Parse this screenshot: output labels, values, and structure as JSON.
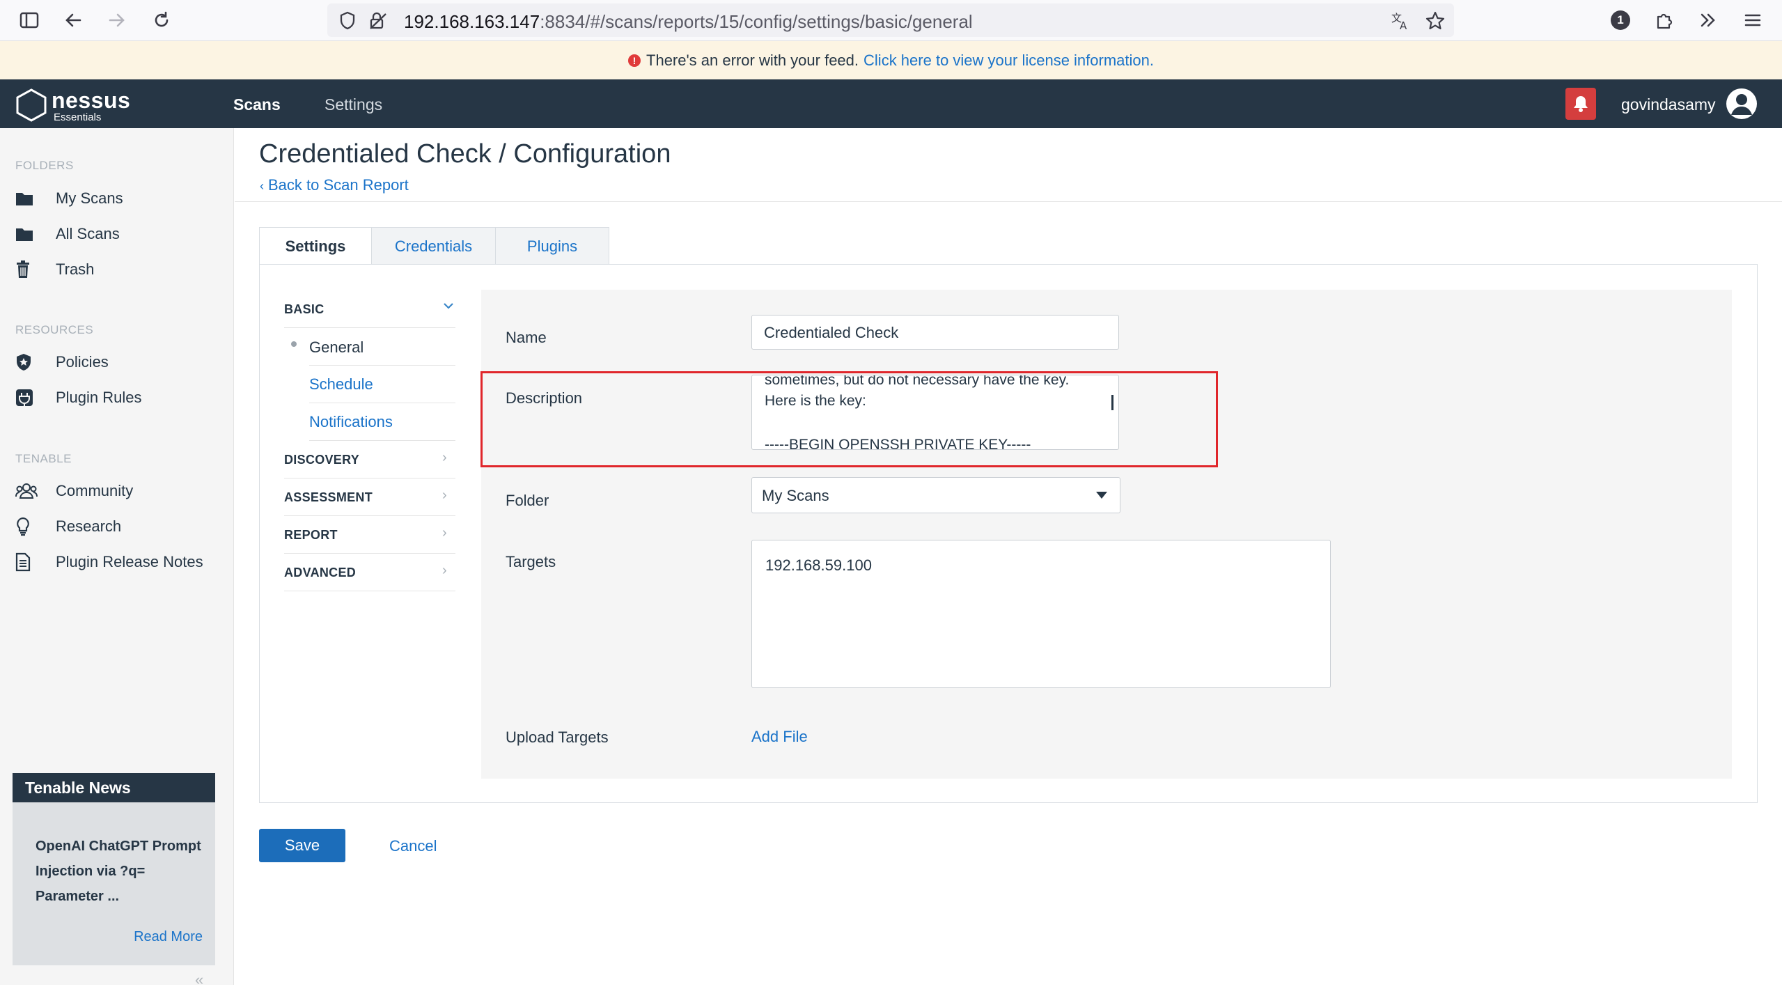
{
  "browser": {
    "url_host": "192.168.163.147",
    "url_rest": ":8834/#/scans/reports/15/config/settings/basic/general",
    "extension_badge": "1"
  },
  "banner": {
    "message": "There's an error with your feed.",
    "link": "Click here to view your license information."
  },
  "header": {
    "logo_word": "nessus",
    "logo_sub": "Essentials",
    "nav": [
      "Scans",
      "Settings"
    ],
    "username": "govindasamy"
  },
  "sidebar": {
    "folders_heading": "FOLDERS",
    "folders": [
      "My Scans",
      "All Scans",
      "Trash"
    ],
    "resources_heading": "RESOURCES",
    "resources": [
      "Policies",
      "Plugin Rules"
    ],
    "tenable_heading": "TENABLE",
    "tenable": [
      "Community",
      "Research",
      "Plugin Release Notes"
    ],
    "news": {
      "heading": "Tenable News",
      "title": "OpenAI ChatGPT Prompt Injection via ?q= Parameter ...",
      "read_more": "Read More"
    },
    "collapse_glyph": "«"
  },
  "page": {
    "title": "Credentialed Check / Configuration",
    "back_link": "Back to Scan Report",
    "tabs": [
      "Settings",
      "Credentials",
      "Plugins"
    ]
  },
  "subnav": {
    "basic": "BASIC",
    "basic_items": [
      "General",
      "Schedule",
      "Notifications"
    ],
    "sections": [
      "DISCOVERY",
      "ASSESSMENT",
      "REPORT",
      "ADVANCED"
    ]
  },
  "form": {
    "name_label": "Name",
    "name_value": "Credentialed Check",
    "description_label": "Description",
    "description_lines": [
      "sometimes, but do not necessary have the key.",
      "Here is the key:",
      "",
      "-----BEGIN OPENSSH PRIVATE KEY-----"
    ],
    "folder_label": "Folder",
    "folder_value": "My Scans",
    "targets_label": "Targets",
    "targets_value": "192.168.59.100",
    "upload_label": "Upload Targets",
    "add_file": "Add File"
  },
  "actions": {
    "save": "Save",
    "cancel": "Cancel"
  },
  "colors": {
    "header_bg": "#263645",
    "link": "#1a73c9",
    "save_bg": "#1c6dba",
    "highlight_box": "#e0262b",
    "bell_bg": "#d43e3e"
  }
}
